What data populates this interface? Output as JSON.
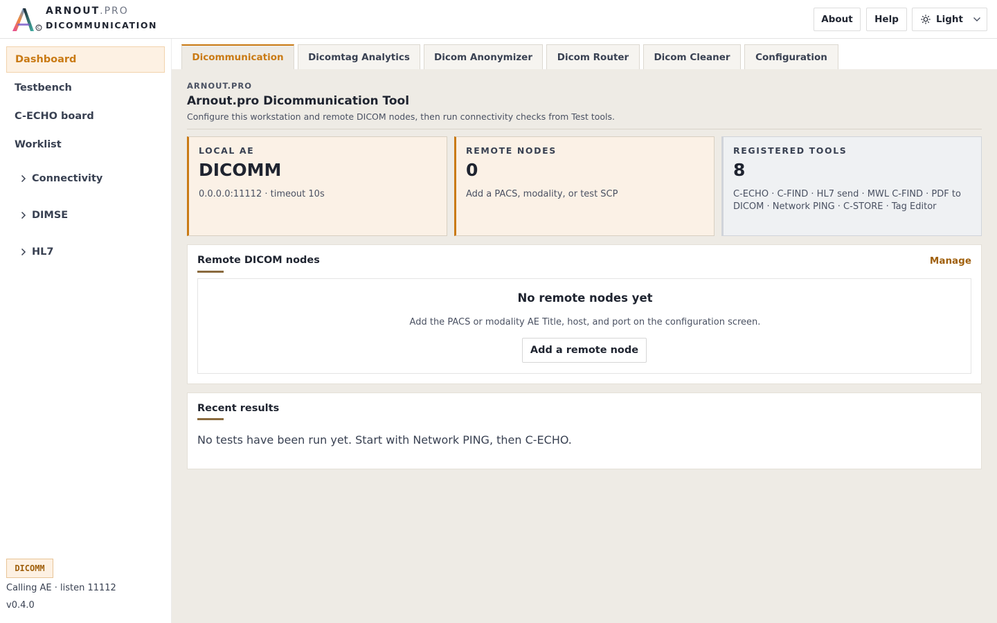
{
  "header": {
    "brand_top": "ARNOUT",
    "brand_top_suffix": ".PRO",
    "brand_bottom": "DICOMMUNICATION",
    "about_label": "About",
    "help_label": "Help",
    "theme_label": "Light",
    "theme_icon": "sun-icon"
  },
  "sidebar": {
    "items": [
      {
        "label": "Dashboard",
        "active": true
      },
      {
        "label": "Testbench"
      },
      {
        "label": "C-ECHO board"
      },
      {
        "label": "Worklist"
      }
    ],
    "groups": [
      {
        "label": "Connectivity"
      },
      {
        "label": "DIMSE"
      },
      {
        "label": "HL7"
      }
    ],
    "footer": {
      "badge": "DICOMM",
      "status": "Calling AE · listen 11112",
      "version": "v0.4.0"
    }
  },
  "tabs": [
    {
      "label": "Dicommunication",
      "active": true
    },
    {
      "label": "Dicomtag Analytics"
    },
    {
      "label": "Dicom Anonymizer"
    },
    {
      "label": "Dicom Router"
    },
    {
      "label": "Dicom Cleaner"
    },
    {
      "label": "Configuration"
    }
  ],
  "page": {
    "eyebrow": "ARNOUT.PRO",
    "title": "Arnout.pro Dicommunication Tool",
    "description": "Configure this workstation and remote DICOM nodes, then run connectivity checks from Test tools."
  },
  "stats": [
    {
      "label": "LOCAL AE",
      "value": "DICOMM",
      "desc": "0.0.0.0:11112 · timeout 10s"
    },
    {
      "label": "REMOTE NODES",
      "value": "0",
      "desc": "Add a PACS, modality, or test SCP"
    },
    {
      "label": "REGISTERED TOOLS",
      "value": "8",
      "desc": "C-ECHO · C-FIND · HL7 send · MWL C-FIND · PDF to DICOM · Network PING · C-STORE · Tag Editor"
    }
  ],
  "remote_nodes": {
    "title": "Remote DICOM nodes",
    "manage_label": "Manage",
    "empty_title": "No remote nodes yet",
    "empty_desc": "Add the PACS or modality AE Title, host, and port on the configuration screen.",
    "add_label": "Add a remote node"
  },
  "recent_results": {
    "title": "Recent results",
    "empty_text": "No tests have been run yet. Start with Network PING, then C-ECHO."
  },
  "colors": {
    "accent": "#c97a14",
    "accent_bg": "#fdf1e3",
    "slate": "#394152",
    "canvas": "#eeebe5"
  }
}
